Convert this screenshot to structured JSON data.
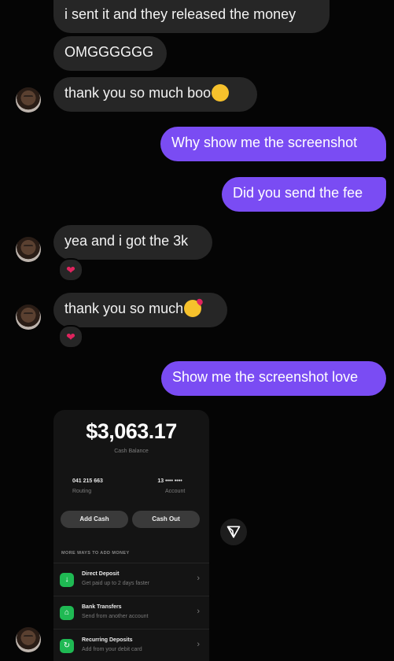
{
  "messages": {
    "m1": "i sent it and they released the money",
    "m2": "OMGGGGGG",
    "m3": "thank you so much boo",
    "m4": "Why show me the screenshot",
    "m5": "Did you send the fee",
    "m6": "yea and i got the 3k",
    "m7": "thank you so much",
    "m8": "Show me the screenshot love"
  },
  "reaction_icon": "heart",
  "colors": {
    "outgoing": "#7a4cf3",
    "incoming": "#262626",
    "reaction": "#e0245e",
    "cash_green": "#1fb953"
  },
  "screenshot": {
    "balance": "$3,063.17",
    "balance_label": "Cash Balance",
    "routing_number": "041 215 663",
    "routing_label": "Routing",
    "account_number": "13 •••• ••••",
    "account_label": "Account",
    "add_cash": "Add Cash",
    "cash_out": "Cash Out",
    "more_ways": "MORE WAYS TO ADD MONEY",
    "rows": [
      {
        "title": "Direct Deposit",
        "subtitle": "Get paid up to 2 days faster",
        "icon": "download-icon"
      },
      {
        "title": "Bank Transfers",
        "subtitle": "Send from another account",
        "icon": "bank-icon"
      },
      {
        "title": "Recurring Deposits",
        "subtitle": "Add from your debit card",
        "icon": "repeat-icon"
      }
    ]
  }
}
